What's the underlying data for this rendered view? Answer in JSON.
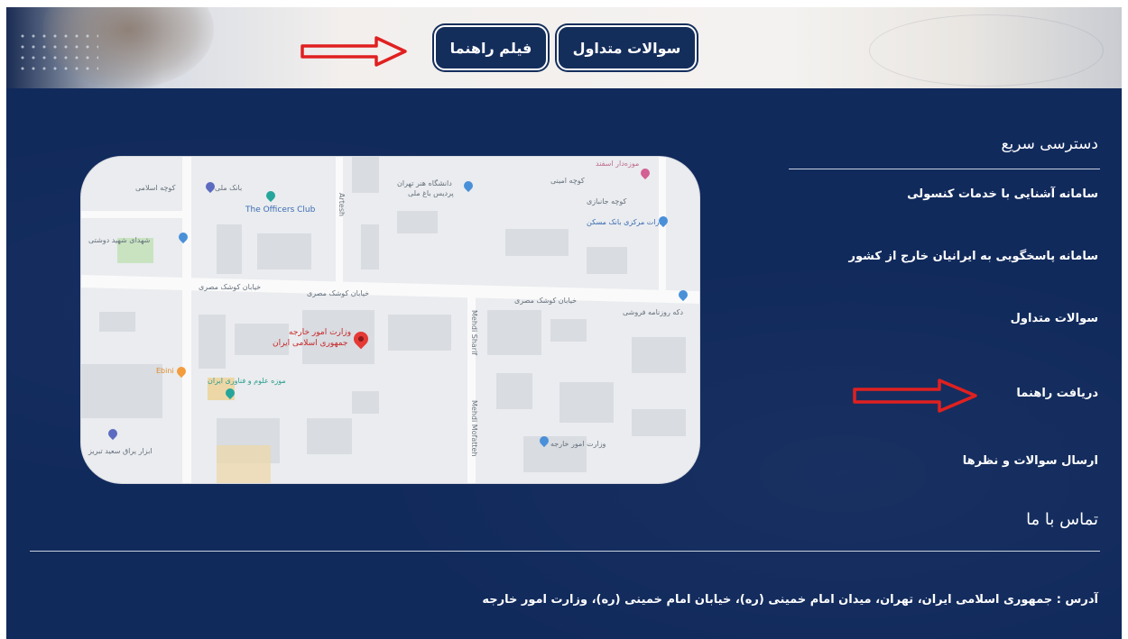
{
  "header": {
    "faq_button": "سوالات متداول",
    "video_button": "فیلم راهنما"
  },
  "quick_access": {
    "title": "دسترسی سریع",
    "links": [
      "سامانه آشنایی با خدمات کنسولی",
      "سامانه پاسخگویی به ایرانیان خارج از کشور",
      "سوالات متداول",
      "دریافت راهنما",
      "ارسال سوالات و نظرها"
    ]
  },
  "contact": {
    "title": "تماس با ما",
    "address": "آدرس : جمهوری اسلامی ایران، تهران، میدان امام خمینی (ره)، خیابان امام خمینی (ره)، وزارت امور خارجه"
  },
  "map": {
    "labels": {
      "officers_club": "The Officers Club",
      "bank_meli": "بانک ملی",
      "university": "دانشگاه هنر تهران",
      "bagh_meli": "پردیس باغ ملی",
      "central_bank": "ادارات مرکزی بانک مسکن",
      "museum_top": "موزه‌دار اسفند",
      "martyrs_sq": "شهدای شهید دوشتی",
      "street_kooshk": "خیابان کوشک مصری",
      "ministry_title": "وزارت امور خارجه",
      "ministry_sub": "جمهوری اسلامی ایران",
      "museum_science": "موزه علوم و فناوری ایران",
      "ebini": "Ebini",
      "shop_rozbeh": "دکه روزنامه فروشی",
      "ministry_small": "وزارت امور خارجه",
      "saeed_tabriz": "ابزار یراق سعید تبریز",
      "artesh": "Artesh",
      "mehdi_sharif": "Mehdi Sharif",
      "mehdi_mofatteh": "Mehdi Mofatteh",
      "koocheh_eslami": "کوچه اسلامی",
      "koocheh_amini": "کوچه امینی",
      "koocheh_janbazi": "کوچه جانبازی"
    }
  },
  "colors": {
    "panel": "#112a5c",
    "button": "#142e5c",
    "arrow": "#e02020",
    "text": "#ffffff"
  }
}
